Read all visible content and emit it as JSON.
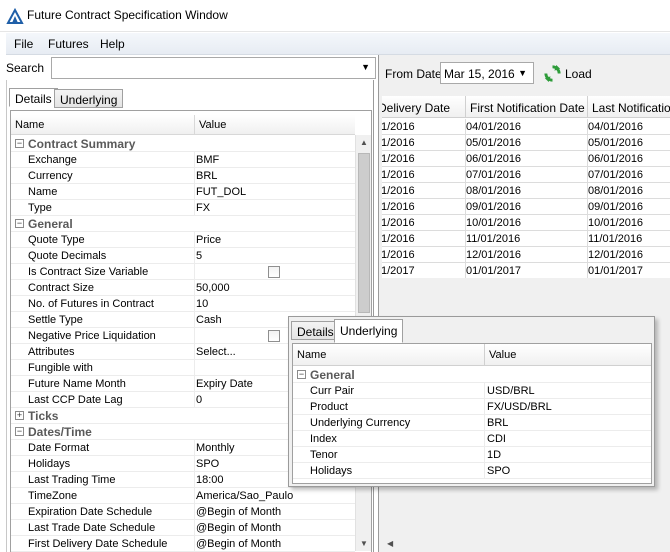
{
  "window": {
    "title": "Future Contract Specification Window"
  },
  "menu": [
    "File",
    "Futures",
    "Help"
  ],
  "search": {
    "label": "Search",
    "value": ""
  },
  "left_tabs": [
    "Details",
    "Underlying"
  ],
  "grid": {
    "headers": {
      "name": "Name",
      "value": "Value"
    },
    "rows": [
      {
        "type": "cat",
        "name": "Contract Summary",
        "exp": "−"
      },
      {
        "name": "Exchange",
        "value": "BMF"
      },
      {
        "name": "Currency",
        "value": "BRL"
      },
      {
        "name": "Name",
        "value": "FUT_DOL"
      },
      {
        "name": "Type",
        "value": "FX"
      },
      {
        "type": "cat",
        "name": "General",
        "exp": "−"
      },
      {
        "name": "Quote Type",
        "value": "Price"
      },
      {
        "name": "Quote Decimals",
        "value": "5"
      },
      {
        "name": "Is Contract Size Variable",
        "value": "",
        "checkbox": true
      },
      {
        "name": "Contract Size",
        "value": "50,000"
      },
      {
        "name": "No. of Futures in Contract",
        "value": "10"
      },
      {
        "name": "Settle Type",
        "value": "Cash"
      },
      {
        "name": "Negative Price Liquidation",
        "value": "",
        "checkbox": true
      },
      {
        "name": "Attributes",
        "value": "Select..."
      },
      {
        "name": "Fungible with",
        "value": ""
      },
      {
        "name": "Future Name Month",
        "value": "Expiry Date"
      },
      {
        "name": "Last CCP Date Lag",
        "value": "0"
      },
      {
        "type": "cat",
        "name": "Ticks",
        "exp": "+"
      },
      {
        "type": "cat",
        "name": "Dates/Time",
        "exp": "−"
      },
      {
        "name": "Date Format",
        "value": "Monthly"
      },
      {
        "name": "Holidays",
        "value": "SPO"
      },
      {
        "name": "Last Trading Time",
        "value": "18:00"
      },
      {
        "name": "TimeZone",
        "value": "America/Sao_Paulo"
      },
      {
        "name": "Expiration Date Schedule",
        "value": "@Begin of Month"
      },
      {
        "name": "Last Trade Date Schedule",
        "value": "@Begin of Month"
      },
      {
        "name": "First Delivery Date Schedule",
        "value": "@Begin of Month"
      }
    ]
  },
  "right": {
    "from_label": "From Date",
    "from_date": "Mar 15, 2016",
    "load_label": "Load",
    "headers": [
      "Delivery Date",
      "First Notification Date",
      "Last Notification"
    ],
    "rows": [
      [
        "1/2016",
        "04/01/2016",
        "04/01/2016"
      ],
      [
        "1/2016",
        "05/01/2016",
        "05/01/2016"
      ],
      [
        "1/2016",
        "06/01/2016",
        "06/01/2016"
      ],
      [
        "1/2016",
        "07/01/2016",
        "07/01/2016"
      ],
      [
        "1/2016",
        "08/01/2016",
        "08/01/2016"
      ],
      [
        "1/2016",
        "09/01/2016",
        "09/01/2016"
      ],
      [
        "1/2016",
        "10/01/2016",
        "10/01/2016"
      ],
      [
        "1/2016",
        "11/01/2016",
        "11/01/2016"
      ],
      [
        "1/2016",
        "12/01/2016",
        "12/01/2016"
      ],
      [
        "1/2017",
        "01/01/2017",
        "01/01/2017"
      ]
    ]
  },
  "popup": {
    "tabs": [
      "Details",
      "Underlying"
    ],
    "headers": {
      "name": "Name",
      "value": "Value"
    },
    "rows": [
      {
        "type": "cat",
        "name": "General",
        "exp": "−"
      },
      {
        "name": "Curr Pair",
        "value": "USD/BRL"
      },
      {
        "name": "Product",
        "value": "FX/USD/BRL"
      },
      {
        "name": "Underlying Currency",
        "value": "BRL"
      },
      {
        "name": "Index",
        "value": "CDI"
      },
      {
        "name": "Tenor",
        "value": "1D"
      },
      {
        "name": "Holidays",
        "value": "SPO"
      }
    ]
  }
}
